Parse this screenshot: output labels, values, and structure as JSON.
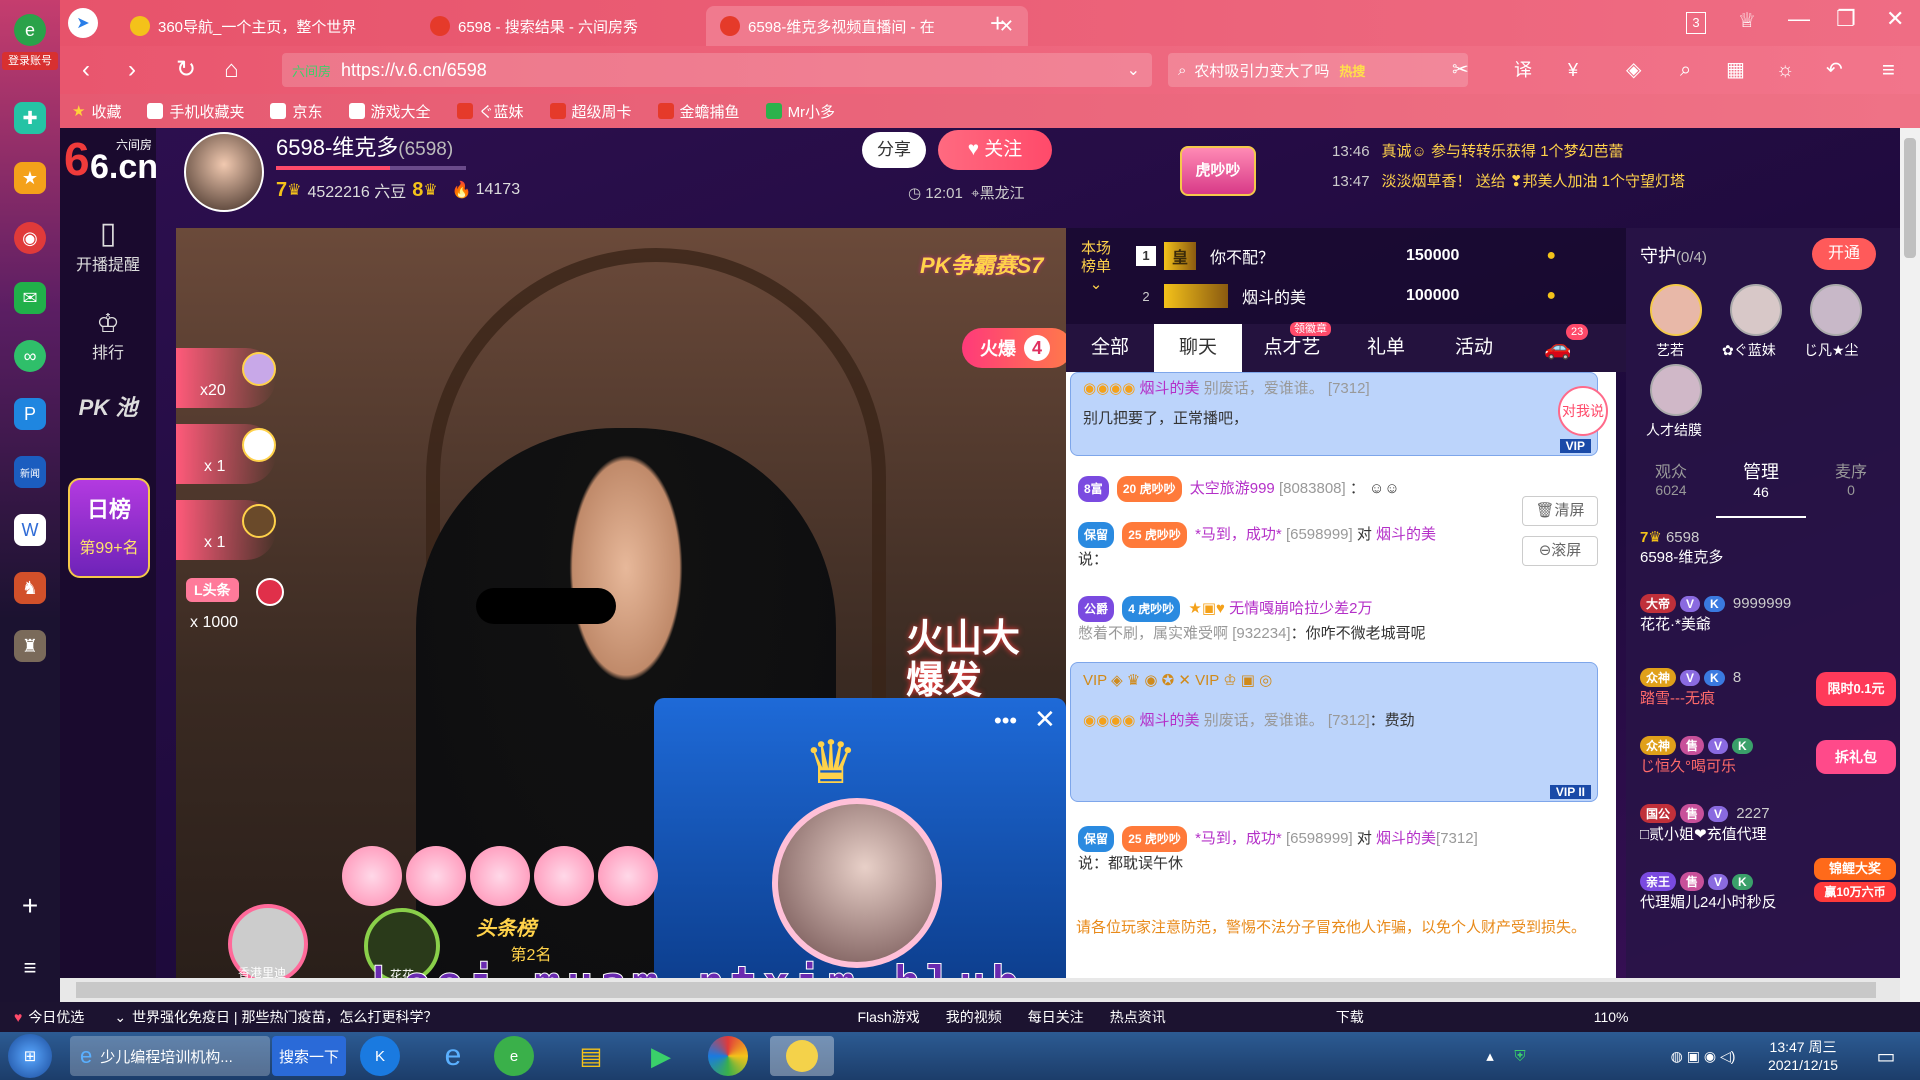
{
  "sidebar": {
    "login_label": "登录账号",
    "icons": [
      "e-browser-icon",
      "mint-icon",
      "star-icon",
      "weibo-icon",
      "mail-icon",
      "loop-icon",
      "p-icon",
      "news-icon",
      "word-icon",
      "game-icon",
      "game2-icon",
      "plus-icon",
      "menu-icon"
    ]
  },
  "tabs": [
    {
      "title": "360导航_一个主页，整个世界",
      "active": false
    },
    {
      "title": "6598 - 搜索结果 - 六间房秀",
      "active": false
    },
    {
      "title": "6598-维克多视频直播间 - 在",
      "active": true
    }
  ],
  "window": {
    "tab_count": "3"
  },
  "address": {
    "site_label": "六间房",
    "url": "https://v.6.cn/6598",
    "search_text": "农村吸引力变大了吗",
    "search_hot": "热搜"
  },
  "bookmarks": [
    "收藏",
    "手机收藏夹",
    "京东",
    "游戏大全",
    "ぐ蓝妹",
    "超级周卡",
    "金蟾捕鱼",
    "Mr小多"
  ],
  "leftnav": {
    "logo_text": "六间房",
    "logo_domain": "6.cn",
    "items": [
      {
        "label": "开播提醒"
      },
      {
        "label": "排行"
      },
      {
        "label": "PK 池"
      }
    ],
    "day_rank_title": "日榜",
    "day_rank_value": "第99+名"
  },
  "anchor": {
    "name": "6598-维克多",
    "room_id": "(6598)",
    "level_left": "7",
    "beans": "4522216 六豆",
    "level_right": "8",
    "fire_count": "14173",
    "share_label": "分享",
    "follow_label": "关注",
    "time": "12:01",
    "location": "黑龙江"
  },
  "badge_center": "虎吵吵",
  "ticker": [
    {
      "time": "13:46",
      "text": "真诚☺ 参与转转乐获得 1个梦幻芭蕾"
    },
    {
      "time": "13:47",
      "text": "淡淡烟草香！ 送给 ❣邦美人加油 1个守望灯塔"
    }
  ],
  "video": {
    "tag_top": "PK争霸赛S7",
    "fire_label": "火爆",
    "fire_num": "4",
    "gifts": [
      {
        "count": "x20"
      },
      {
        "count": "x 1"
      },
      {
        "count": "x 1"
      },
      {
        "label": "L头条",
        "count": "x 1000"
      }
    ],
    "promo": "火山大爆发",
    "bottom_users": [
      "香港里迪",
      "花花"
    ],
    "headline": "头条榜",
    "headline_rank": "第2名",
    "overlay_text": "Leej muam ntxim hlub"
  },
  "rank": {
    "label_top": "本场",
    "label_bottom": "榜单",
    "rows": [
      {
        "rank": "1",
        "badge": "皇",
        "name": "你不配？",
        "coins": "150000"
      },
      {
        "rank": "2",
        "badge": "",
        "name": "烟斗的美",
        "coins": "100000"
      }
    ]
  },
  "chat_tabs": [
    {
      "label": "全部",
      "active": false
    },
    {
      "label": "聊天",
      "active": true
    },
    {
      "label": "点才艺",
      "active": false,
      "badge": "领徽章"
    },
    {
      "label": "礼单",
      "active": false
    },
    {
      "label": "活动",
      "active": false
    },
    {
      "label": "",
      "active": false,
      "badge": "23"
    }
  ],
  "chat": [
    {
      "user": "烟斗的美",
      "text": "别废话，爱谁谁。",
      "id": "[7312]",
      "tail": "别几把要了，正常播吧，",
      "vip": "VIP"
    },
    {
      "tag": "8富",
      "level": "20",
      "title": "虎吵吵",
      "user": "太空旅游999",
      "id": "[8083808]",
      "text": "："
    },
    {
      "tag": "保留",
      "level": "25",
      "title": "虎吵吵",
      "user": "*马到，成功*",
      "id": "[6598999]",
      "mid": "对",
      "target": "烟斗的美",
      "text": "说："
    },
    {
      "tag": "公爵",
      "level": "4",
      "title": "虎吵吵",
      "user": "无情嘎崩哈拉少差2万",
      "text": "憋着不刷，属实难受啊",
      "id": "[932234]",
      "tail": "：你咋不微老城哥呢"
    },
    {
      "user": "烟斗的美",
      "text": "别废话，爱谁谁。",
      "id": "[7312]",
      "tail": "：费劲",
      "vip": "VIP II"
    },
    {
      "tag": "保留",
      "level": "25",
      "title": "虎吵吵",
      "user": "*马到，成功*",
      "id": "[6598999]",
      "mid": "对",
      "target": "烟斗的美",
      "target_id": "[7312]",
      "text": "说：都耽误午休"
    }
  ],
  "chat_tools": {
    "tome": "对我说",
    "clear": "清屏",
    "scroll": "滚屏"
  },
  "notice": "请各位玩家注意防范，警惕不法分子冒充他人诈骗，以免个人财产受到损失。",
  "guard": {
    "title": "守护",
    "count": "(0/4)",
    "open_label": "开通",
    "avatars": [
      "艺若",
      "✿ぐ蓝妹",
      "じ凡★尘",
      "人才结膜"
    ],
    "tabs": [
      {
        "label": "观众",
        "value": "6024"
      },
      {
        "label": "管理",
        "value": "46"
      },
      {
        "label": "麦序",
        "value": "0"
      }
    ],
    "users": [
      {
        "tag": "7",
        "extra": "6598",
        "name": "6598-维克多"
      },
      {
        "tag": "大帝",
        "extra": "9999999",
        "name": "花花·*美爺"
      },
      {
        "tag": "众神",
        "extra": "8",
        "name": "踏雪---无痕"
      },
      {
        "tag": "众神",
        "extra": "",
        "name": "じ恒久°喝可乐"
      },
      {
        "tag": "国公",
        "extra": "2227",
        "name": "□贰小姐❤充值代理"
      },
      {
        "tag": "亲王",
        "extra": "",
        "name": "代理媚儿24小时秒反"
      }
    ],
    "promos": [
      "限时0.1元",
      "拆礼包",
      "锦鲤大奖",
      "赢10万六币"
    ]
  },
  "statusbar": {
    "items": [
      "今日优选",
      "世界强化免疫日 | 那些热门疫苗，怎么打更科学？",
      "Flash游戏",
      "我的视频",
      "每日关注",
      "热点资讯",
      "下载",
      "110%"
    ]
  },
  "taskbar": {
    "task_title": "少儿编程培训机构...",
    "search_btn": "搜索一下",
    "time": "13:47 周三",
    "date": "2021/12/15"
  }
}
